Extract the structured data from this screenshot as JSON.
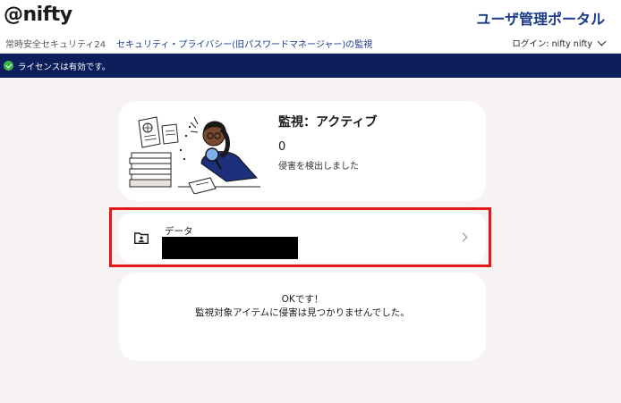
{
  "header": {
    "logo": "@nifty",
    "portal_title": "ユーザ管理ポータル"
  },
  "nav": {
    "product": "常時安全セキュリティ24",
    "section_link": "セキュリティ・プライバシー(旧パスワードマネージャー)の監視",
    "login_label": "ログイン: nifty nifty"
  },
  "license": {
    "message": "ライセンスは有効です。",
    "status_color": "#3bb54a"
  },
  "status": {
    "title": "監視：アクティブ",
    "breach_count": "0",
    "description": "侵害を検出しました"
  },
  "data_item": {
    "label": "データ",
    "value_redacted": true,
    "icon": "folder-person-icon"
  },
  "result": {
    "title": "OKです！",
    "description": "監視対象アイテムに侵害は見つかりませんでした。"
  },
  "colors": {
    "brand_navy": "#0c1f5c",
    "link_blue": "#1a3a8a",
    "highlight_red": "#e0191b",
    "background": "#f6f3f2"
  }
}
